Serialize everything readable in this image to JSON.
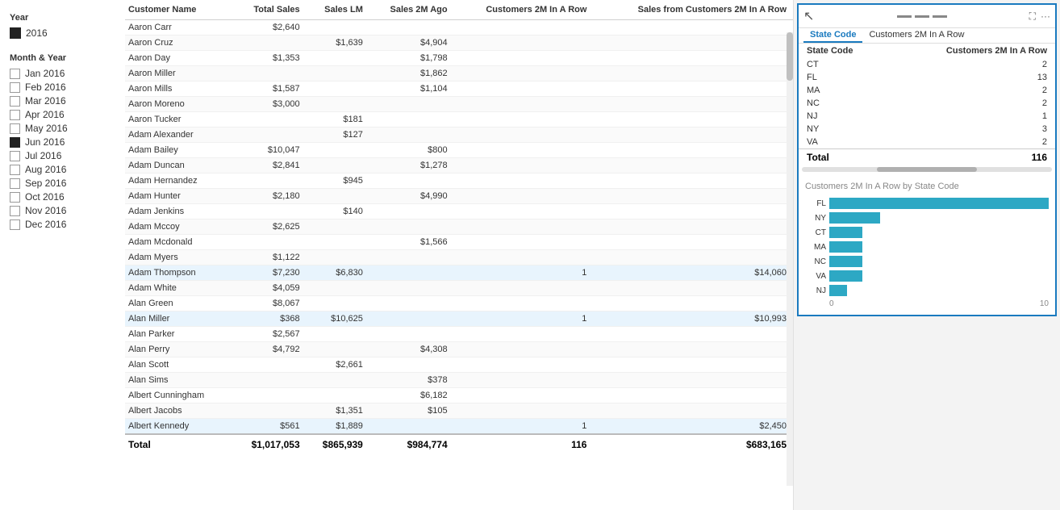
{
  "filters": {
    "year_title": "Year",
    "year_value": "2016",
    "month_title": "Month & Year",
    "months": [
      {
        "label": "Jan 2016",
        "checked": false
      },
      {
        "label": "Feb 2016",
        "checked": false
      },
      {
        "label": "Mar 2016",
        "checked": false
      },
      {
        "label": "Apr 2016",
        "checked": false
      },
      {
        "label": "May 2016",
        "checked": false
      },
      {
        "label": "Jun 2016",
        "checked": true
      },
      {
        "label": "Jul 2016",
        "checked": false
      },
      {
        "label": "Aug 2016",
        "checked": false
      },
      {
        "label": "Sep 2016",
        "checked": false
      },
      {
        "label": "Oct 2016",
        "checked": false
      },
      {
        "label": "Nov 2016",
        "checked": false
      },
      {
        "label": "Dec 2016",
        "checked": false
      }
    ]
  },
  "table": {
    "columns": [
      "Customer Name",
      "Total Sales",
      "Sales LM",
      "Sales 2M Ago",
      "Customers 2M In A Row",
      "Sales from Customers 2M In A Row"
    ],
    "rows": [
      {
        "name": "Aaron Carr",
        "total": "$2,640",
        "lm": "",
        "ago2m": "",
        "cust2m": "",
        "sales2m": ""
      },
      {
        "name": "Aaron Cruz",
        "total": "",
        "lm": "$1,639",
        "ago2m": "$4,904",
        "cust2m": "",
        "sales2m": ""
      },
      {
        "name": "Aaron Day",
        "total": "$1,353",
        "lm": "",
        "ago2m": "$1,798",
        "cust2m": "",
        "sales2m": ""
      },
      {
        "name": "Aaron Miller",
        "total": "",
        "lm": "",
        "ago2m": "$1,862",
        "cust2m": "",
        "sales2m": ""
      },
      {
        "name": "Aaron Mills",
        "total": "$1,587",
        "lm": "",
        "ago2m": "$1,104",
        "cust2m": "",
        "sales2m": ""
      },
      {
        "name": "Aaron Moreno",
        "total": "$3,000",
        "lm": "",
        "ago2m": "",
        "cust2m": "",
        "sales2m": ""
      },
      {
        "name": "Aaron Tucker",
        "total": "",
        "lm": "$181",
        "ago2m": "",
        "cust2m": "",
        "sales2m": ""
      },
      {
        "name": "Adam Alexander",
        "total": "",
        "lm": "$127",
        "ago2m": "",
        "cust2m": "",
        "sales2m": ""
      },
      {
        "name": "Adam Bailey",
        "total": "$10,047",
        "lm": "",
        "ago2m": "$800",
        "cust2m": "",
        "sales2m": ""
      },
      {
        "name": "Adam Duncan",
        "total": "$2,841",
        "lm": "",
        "ago2m": "$1,278",
        "cust2m": "",
        "sales2m": ""
      },
      {
        "name": "Adam Hernandez",
        "total": "",
        "lm": "$945",
        "ago2m": "",
        "cust2m": "",
        "sales2m": ""
      },
      {
        "name": "Adam Hunter",
        "total": "$2,180",
        "lm": "",
        "ago2m": "$4,990",
        "cust2m": "",
        "sales2m": ""
      },
      {
        "name": "Adam Jenkins",
        "total": "",
        "lm": "$140",
        "ago2m": "",
        "cust2m": "",
        "sales2m": ""
      },
      {
        "name": "Adam Mccoy",
        "total": "$2,625",
        "lm": "",
        "ago2m": "",
        "cust2m": "",
        "sales2m": ""
      },
      {
        "name": "Adam Mcdonald",
        "total": "",
        "lm": "",
        "ago2m": "$1,566",
        "cust2m": "",
        "sales2m": ""
      },
      {
        "name": "Adam Myers",
        "total": "$1,122",
        "lm": "",
        "ago2m": "",
        "cust2m": "",
        "sales2m": ""
      },
      {
        "name": "Adam Thompson",
        "total": "$7,230",
        "lm": "$6,830",
        "ago2m": "",
        "cust2m": "1",
        "sales2m": "$14,060"
      },
      {
        "name": "Adam White",
        "total": "$4,059",
        "lm": "",
        "ago2m": "",
        "cust2m": "",
        "sales2m": ""
      },
      {
        "name": "Alan Green",
        "total": "$8,067",
        "lm": "",
        "ago2m": "",
        "cust2m": "",
        "sales2m": ""
      },
      {
        "name": "Alan Miller",
        "total": "$368",
        "lm": "$10,625",
        "ago2m": "",
        "cust2m": "1",
        "sales2m": "$10,993"
      },
      {
        "name": "Alan Parker",
        "total": "$2,567",
        "lm": "",
        "ago2m": "",
        "cust2m": "",
        "sales2m": ""
      },
      {
        "name": "Alan Perry",
        "total": "$4,792",
        "lm": "",
        "ago2m": "$4,308",
        "cust2m": "",
        "sales2m": ""
      },
      {
        "name": "Alan Scott",
        "total": "",
        "lm": "$2,661",
        "ago2m": "",
        "cust2m": "",
        "sales2m": ""
      },
      {
        "name": "Alan Sims",
        "total": "",
        "lm": "",
        "ago2m": "$378",
        "cust2m": "",
        "sales2m": ""
      },
      {
        "name": "Albert Cunningham",
        "total": "",
        "lm": "",
        "ago2m": "$6,182",
        "cust2m": "",
        "sales2m": ""
      },
      {
        "name": "Albert Jacobs",
        "total": "",
        "lm": "$1,351",
        "ago2m": "$105",
        "cust2m": "",
        "sales2m": ""
      },
      {
        "name": "Albert Kennedy",
        "total": "$561",
        "lm": "$1,889",
        "ago2m": "",
        "cust2m": "1",
        "sales2m": "$2,450"
      }
    ],
    "footer": {
      "label": "Total",
      "total": "$1,017,053",
      "lm": "$865,939",
      "ago2m": "$984,774",
      "cust2m": "116",
      "sales2m": "$683,165"
    }
  },
  "tooltip": {
    "tab1": "State Code",
    "tab2": "Customers 2M In A Row",
    "chart_title": "Customers 2M In A Row by State Code",
    "rows": [
      {
        "state": "CT",
        "value": 2
      },
      {
        "state": "FL",
        "value": 13
      },
      {
        "state": "MA",
        "value": 2
      },
      {
        "state": "NC",
        "value": 2
      },
      {
        "state": "NJ",
        "value": 1
      },
      {
        "state": "NY",
        "value": 3
      },
      {
        "state": "VA",
        "value": 2
      }
    ],
    "footer_label": "Total",
    "footer_value": 116,
    "chart_bars": [
      {
        "label": "FL",
        "value": 13,
        "pct": 100
      },
      {
        "label": "NY",
        "value": 3,
        "pct": 23
      },
      {
        "label": "CT",
        "value": 2,
        "pct": 15
      },
      {
        "label": "MA",
        "value": 2,
        "pct": 15
      },
      {
        "label": "NC",
        "value": 2,
        "pct": 15
      },
      {
        "label": "VA",
        "value": 2,
        "pct": 15
      },
      {
        "label": "NJ",
        "value": 1,
        "pct": 8
      }
    ],
    "axis_start": "0",
    "axis_end": "10"
  }
}
